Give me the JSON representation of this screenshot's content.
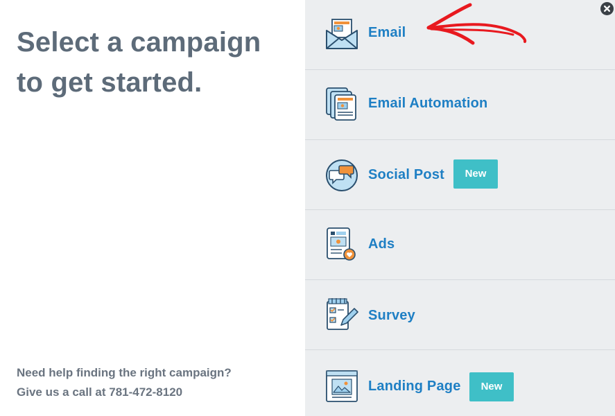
{
  "headline": {
    "line1": "Select a campaign",
    "line2": "to get started."
  },
  "help": {
    "line1": "Need help finding the right campaign?",
    "line2": "Give us a call at 781-472-8120"
  },
  "close_icon": "close-icon",
  "campaigns": [
    {
      "label": "Email",
      "icon": "email-icon",
      "badge": ""
    },
    {
      "label": "Email Automation",
      "icon": "email-automation-icon",
      "badge": ""
    },
    {
      "label": "Social Post",
      "icon": "social-post-icon",
      "badge": "New"
    },
    {
      "label": "Ads",
      "icon": "ads-icon",
      "badge": ""
    },
    {
      "label": "Survey",
      "icon": "survey-icon",
      "badge": ""
    },
    {
      "label": "Landing Page",
      "icon": "landing-page-icon",
      "badge": "New"
    }
  ],
  "colors": {
    "headline": "#5d6b79",
    "link": "#1e7fc4",
    "badge": "#3fbfc7",
    "panel": "#eceef0",
    "annotation_arrow": "#e8191f"
  }
}
